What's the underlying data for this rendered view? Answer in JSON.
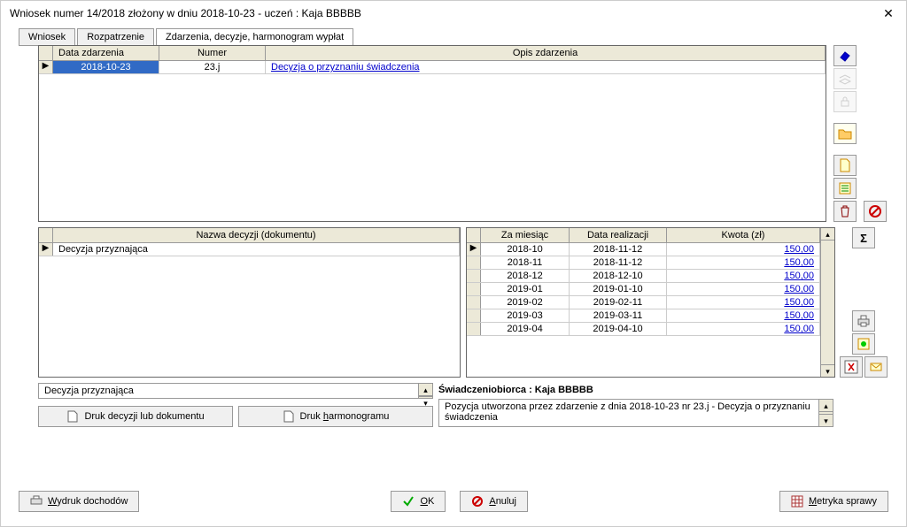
{
  "title": "Wniosek numer 14/2018 złożony w dniu 2018-10-23 - uczeń : Kaja BBBBB",
  "tabs": [
    "Wniosek",
    "Rozpatrzenie",
    "Zdarzenia, decyzje, harmonogram wypłat"
  ],
  "events": {
    "headers": [
      "Data zdarzenia",
      "Numer",
      "Opis zdarzenia"
    ],
    "rows": [
      {
        "date": "2018-10-23",
        "num": "23.j",
        "desc": "Decyzja o przyznaniu świadczenia"
      }
    ]
  },
  "decisions": {
    "header": "Nazwa decyzji (dokumentu)",
    "rows": [
      "Decyzja przyznająca"
    ]
  },
  "schedule": {
    "headers": [
      "Za miesiąc",
      "Data realizacji",
      "Kwota (zł)"
    ],
    "rows": [
      {
        "m": "2018-10",
        "d": "2018-11-12",
        "k": "150,00"
      },
      {
        "m": "2018-11",
        "d": "2018-11-12",
        "k": "150,00"
      },
      {
        "m": "2018-12",
        "d": "2018-12-10",
        "k": "150,00"
      },
      {
        "m": "2019-01",
        "d": "2019-01-10",
        "k": "150,00"
      },
      {
        "m": "2019-02",
        "d": "2019-02-11",
        "k": "150,00"
      },
      {
        "m": "2019-03",
        "d": "2019-03-11",
        "k": "150,00"
      },
      {
        "m": "2019-04",
        "d": "2019-04-10",
        "k": "150,00"
      }
    ]
  },
  "decision_text": "Decyzja przyznająca",
  "beneficiary_label": "Świadczeniobiorca : Kaja BBBBB",
  "position_text": "Pozycja utworzona przez zdarzenie z dnia 2018-10-23 nr 23.j - Decyzja o przyznaniu świadczenia",
  "buttons": {
    "print_decision": "Druk decyzji lub dokumentu",
    "print_schedule": "Druk harmonogramu",
    "print_income": "Wydruk dochodów",
    "ok": "OK",
    "cancel": "Anuluj",
    "metric": "Metryka sprawy"
  },
  "icons": {
    "sum": "Σ"
  }
}
